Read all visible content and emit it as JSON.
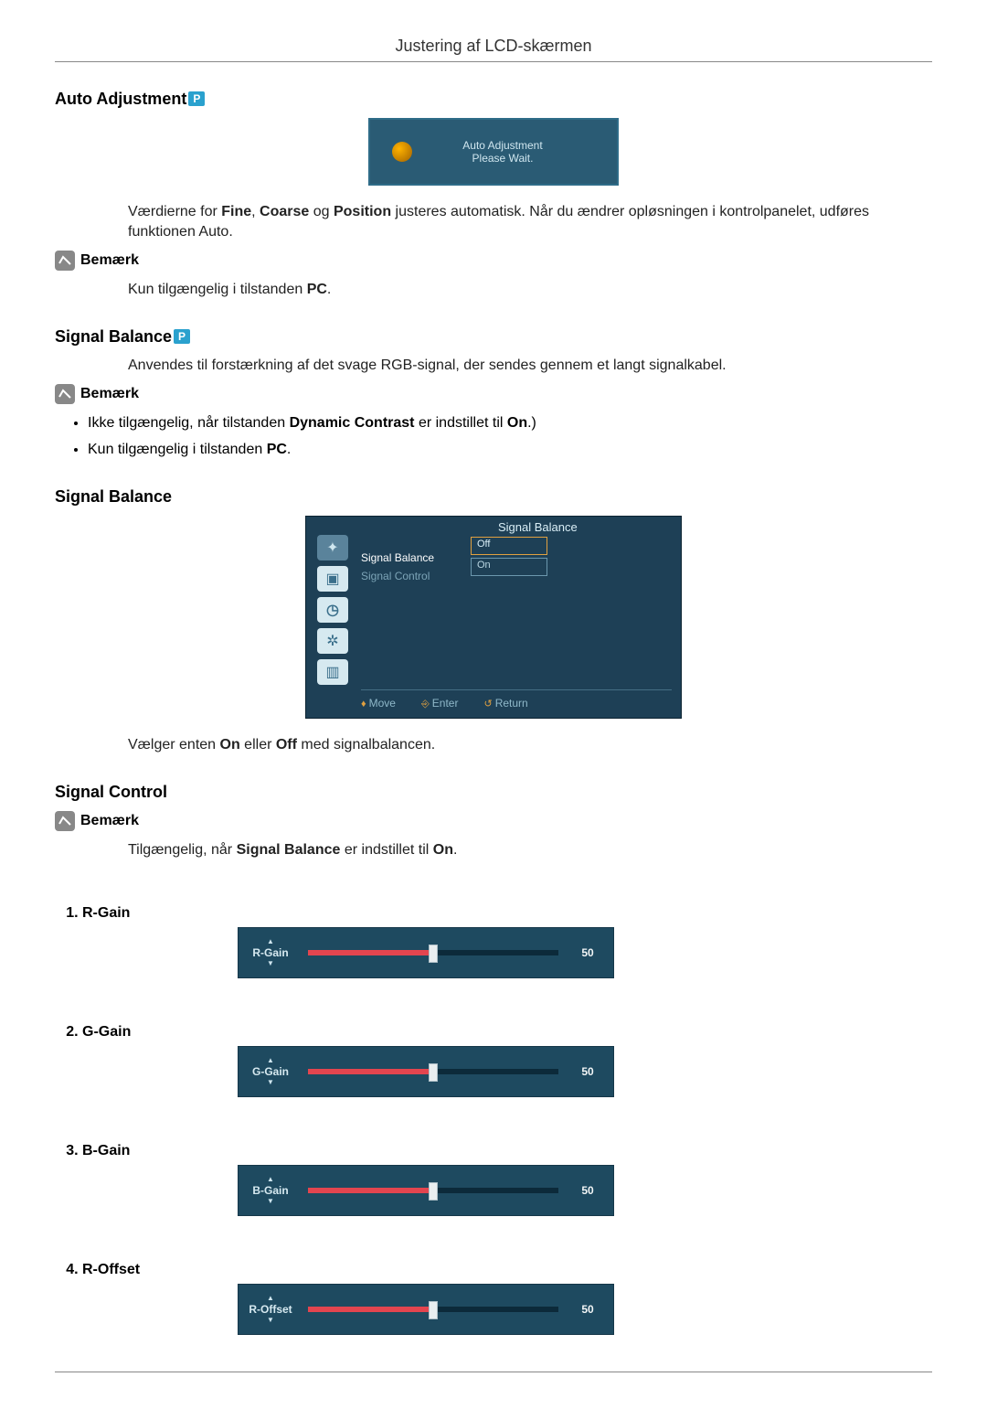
{
  "page": {
    "title": "Justering af LCD-skærmen"
  },
  "auto_adj": {
    "heading": "Auto Adjustment",
    "badge": "P",
    "panel": {
      "line1": "Auto Adjustment",
      "line2": "Please Wait."
    },
    "p_pre": "Værdierne for ",
    "b1": "Fine",
    "sep1": ", ",
    "b2": "Coarse",
    "sep2": " og ",
    "b3": "Position",
    "p_post": " justeres automatisk. Når du ændrer opløsningen i kontrolpanelet, udføres funktionen Auto.",
    "note": "Bemærk",
    "avail_pre": "Kun tilgængelig i tilstanden ",
    "avail_b": "PC",
    "avail_post": "."
  },
  "sig_bal_intro": {
    "heading": "Signal Balance",
    "badge": "P",
    "desc": "Anvendes til forstærkning af det svage RGB-signal, der sendes gennem et langt signalkabel.",
    "note": "Bemærk",
    "b1_pre": "Ikke tilgængelig, når tilstanden ",
    "b1_b": "Dynamic Contrast",
    "b1_mid": " er indstillet til ",
    "b1_b2": "On",
    "b1_post": ".)",
    "b2_pre": "Kun tilgængelig i tilstanden ",
    "b2_b": "PC",
    "b2_post": "."
  },
  "sig_bal_panel": {
    "heading": "Signal Balance",
    "osd_title": "Signal Balance",
    "row1": "Signal Balance",
    "row2": "Signal Control",
    "opt_off": "Off",
    "opt_on": "On",
    "footer_move": "Move",
    "footer_enter": "Enter",
    "footer_return": "Return",
    "desc_pre": "Vælger enten ",
    "desc_b1": "On",
    "desc_mid": " eller ",
    "desc_b2": "Off",
    "desc_post": " med signalbalancen."
  },
  "sig_ctrl": {
    "heading": "Signal Control",
    "note": "Bemærk",
    "avail_pre": "Tilgængelig, når ",
    "avail_b": "Signal Balance",
    "avail_mid": " er indstillet til ",
    "avail_b2": "On",
    "avail_post": ".",
    "items": [
      {
        "label": "R-Gain",
        "slider_label": "R-Gain",
        "value": "50"
      },
      {
        "label": "G-Gain",
        "slider_label": "G-Gain",
        "value": "50"
      },
      {
        "label": "B-Gain",
        "slider_label": "B-Gain",
        "value": "50"
      },
      {
        "label": "R-Offset",
        "slider_label": "R-Offset",
        "value": "50"
      }
    ]
  }
}
